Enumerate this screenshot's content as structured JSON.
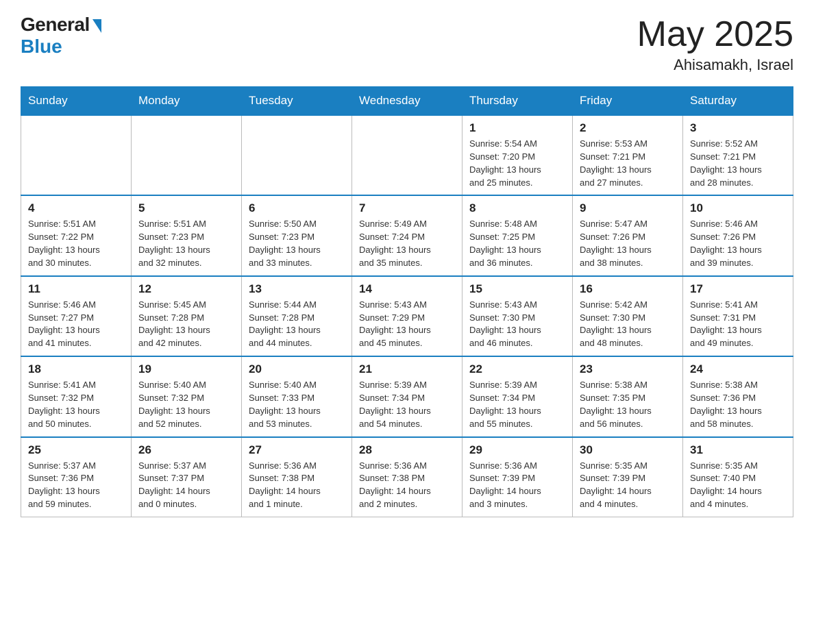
{
  "header": {
    "logo_general": "General",
    "logo_blue": "Blue",
    "month_title": "May 2025",
    "location": "Ahisamakh, Israel"
  },
  "weekdays": [
    "Sunday",
    "Monday",
    "Tuesday",
    "Wednesday",
    "Thursday",
    "Friday",
    "Saturday"
  ],
  "weeks": [
    [
      {
        "day": "",
        "info": ""
      },
      {
        "day": "",
        "info": ""
      },
      {
        "day": "",
        "info": ""
      },
      {
        "day": "",
        "info": ""
      },
      {
        "day": "1",
        "info": "Sunrise: 5:54 AM\nSunset: 7:20 PM\nDaylight: 13 hours\nand 25 minutes."
      },
      {
        "day": "2",
        "info": "Sunrise: 5:53 AM\nSunset: 7:21 PM\nDaylight: 13 hours\nand 27 minutes."
      },
      {
        "day": "3",
        "info": "Sunrise: 5:52 AM\nSunset: 7:21 PM\nDaylight: 13 hours\nand 28 minutes."
      }
    ],
    [
      {
        "day": "4",
        "info": "Sunrise: 5:51 AM\nSunset: 7:22 PM\nDaylight: 13 hours\nand 30 minutes."
      },
      {
        "day": "5",
        "info": "Sunrise: 5:51 AM\nSunset: 7:23 PM\nDaylight: 13 hours\nand 32 minutes."
      },
      {
        "day": "6",
        "info": "Sunrise: 5:50 AM\nSunset: 7:23 PM\nDaylight: 13 hours\nand 33 minutes."
      },
      {
        "day": "7",
        "info": "Sunrise: 5:49 AM\nSunset: 7:24 PM\nDaylight: 13 hours\nand 35 minutes."
      },
      {
        "day": "8",
        "info": "Sunrise: 5:48 AM\nSunset: 7:25 PM\nDaylight: 13 hours\nand 36 minutes."
      },
      {
        "day": "9",
        "info": "Sunrise: 5:47 AM\nSunset: 7:26 PM\nDaylight: 13 hours\nand 38 minutes."
      },
      {
        "day": "10",
        "info": "Sunrise: 5:46 AM\nSunset: 7:26 PM\nDaylight: 13 hours\nand 39 minutes."
      }
    ],
    [
      {
        "day": "11",
        "info": "Sunrise: 5:46 AM\nSunset: 7:27 PM\nDaylight: 13 hours\nand 41 minutes."
      },
      {
        "day": "12",
        "info": "Sunrise: 5:45 AM\nSunset: 7:28 PM\nDaylight: 13 hours\nand 42 minutes."
      },
      {
        "day": "13",
        "info": "Sunrise: 5:44 AM\nSunset: 7:28 PM\nDaylight: 13 hours\nand 44 minutes."
      },
      {
        "day": "14",
        "info": "Sunrise: 5:43 AM\nSunset: 7:29 PM\nDaylight: 13 hours\nand 45 minutes."
      },
      {
        "day": "15",
        "info": "Sunrise: 5:43 AM\nSunset: 7:30 PM\nDaylight: 13 hours\nand 46 minutes."
      },
      {
        "day": "16",
        "info": "Sunrise: 5:42 AM\nSunset: 7:30 PM\nDaylight: 13 hours\nand 48 minutes."
      },
      {
        "day": "17",
        "info": "Sunrise: 5:41 AM\nSunset: 7:31 PM\nDaylight: 13 hours\nand 49 minutes."
      }
    ],
    [
      {
        "day": "18",
        "info": "Sunrise: 5:41 AM\nSunset: 7:32 PM\nDaylight: 13 hours\nand 50 minutes."
      },
      {
        "day": "19",
        "info": "Sunrise: 5:40 AM\nSunset: 7:32 PM\nDaylight: 13 hours\nand 52 minutes."
      },
      {
        "day": "20",
        "info": "Sunrise: 5:40 AM\nSunset: 7:33 PM\nDaylight: 13 hours\nand 53 minutes."
      },
      {
        "day": "21",
        "info": "Sunrise: 5:39 AM\nSunset: 7:34 PM\nDaylight: 13 hours\nand 54 minutes."
      },
      {
        "day": "22",
        "info": "Sunrise: 5:39 AM\nSunset: 7:34 PM\nDaylight: 13 hours\nand 55 minutes."
      },
      {
        "day": "23",
        "info": "Sunrise: 5:38 AM\nSunset: 7:35 PM\nDaylight: 13 hours\nand 56 minutes."
      },
      {
        "day": "24",
        "info": "Sunrise: 5:38 AM\nSunset: 7:36 PM\nDaylight: 13 hours\nand 58 minutes."
      }
    ],
    [
      {
        "day": "25",
        "info": "Sunrise: 5:37 AM\nSunset: 7:36 PM\nDaylight: 13 hours\nand 59 minutes."
      },
      {
        "day": "26",
        "info": "Sunrise: 5:37 AM\nSunset: 7:37 PM\nDaylight: 14 hours\nand 0 minutes."
      },
      {
        "day": "27",
        "info": "Sunrise: 5:36 AM\nSunset: 7:38 PM\nDaylight: 14 hours\nand 1 minute."
      },
      {
        "day": "28",
        "info": "Sunrise: 5:36 AM\nSunset: 7:38 PM\nDaylight: 14 hours\nand 2 minutes."
      },
      {
        "day": "29",
        "info": "Sunrise: 5:36 AM\nSunset: 7:39 PM\nDaylight: 14 hours\nand 3 minutes."
      },
      {
        "day": "30",
        "info": "Sunrise: 5:35 AM\nSunset: 7:39 PM\nDaylight: 14 hours\nand 4 minutes."
      },
      {
        "day": "31",
        "info": "Sunrise: 5:35 AM\nSunset: 7:40 PM\nDaylight: 14 hours\nand 4 minutes."
      }
    ]
  ]
}
